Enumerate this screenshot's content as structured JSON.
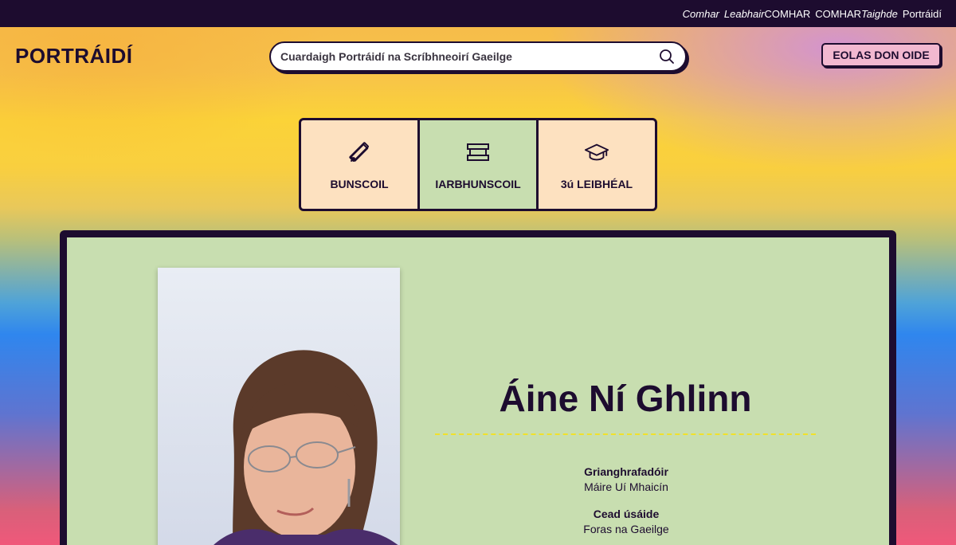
{
  "topbar": {
    "links": [
      {
        "label": "Comhar",
        "italic": true
      },
      {
        "label": "Leabhair",
        "italic": true
      },
      {
        "label": "COMHAR",
        "italic": false
      },
      {
        "label": "COMHAR",
        "italic": false
      },
      {
        "label": "Taighde",
        "italic": true
      },
      {
        "label": "Portráidí",
        "italic": false
      }
    ]
  },
  "header": {
    "logo": "PORTRÁIDÍ",
    "search_placeholder": "Cuardaigh Portráidí na Scríbhneoirí Gaeilge",
    "search_icon": "search-icon",
    "teacher_button": "EOLAS DON OIDE"
  },
  "levels": [
    {
      "label": "BUNSCOIL",
      "icon": "pencil-ruler-icon",
      "active": false
    },
    {
      "label": "IARBHUNSCOIL",
      "icon": "books-stack-icon",
      "active": true
    },
    {
      "label": "3ú LEIBHÉAL",
      "icon": "graduation-cap-icon",
      "active": false
    }
  ],
  "profile": {
    "name": "Áine Ní Ghlinn",
    "photographer_label": "Grianghrafadóir",
    "photographer": "Máire Uí Mhaicín",
    "license_label": "Cead úsáide",
    "license": "Foras na Gaeilge"
  },
  "colors": {
    "dark": "#1d0c2f",
    "card_bg": "#c8deb0",
    "tab_bg": "#fde1c0",
    "button_pink": "#f2b8d0",
    "divider_yellow": "#f1e12a"
  }
}
